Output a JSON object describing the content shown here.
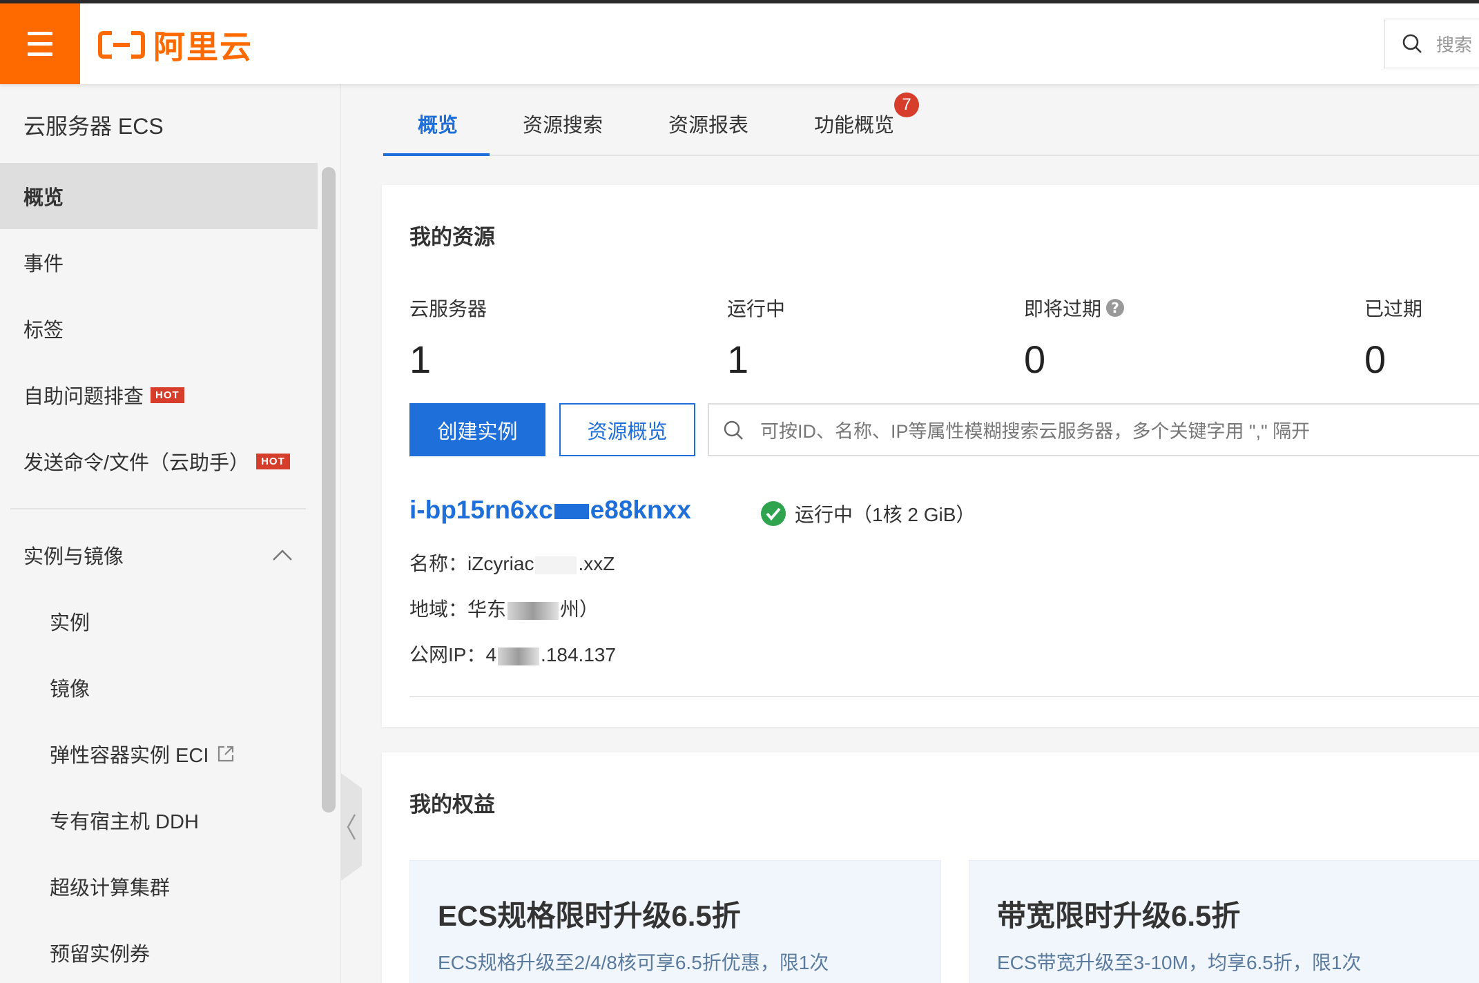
{
  "header": {
    "logo_text": "阿里云",
    "search_placeholder": "搜索"
  },
  "sidebar": {
    "title": "云服务器 ECS",
    "items": [
      {
        "label": "概览",
        "active": true
      },
      {
        "label": "事件"
      },
      {
        "label": "标签"
      },
      {
        "label": "自助问题排查",
        "badge": "HOT"
      },
      {
        "label": "发送命令/文件（云助手）",
        "badge": "HOT"
      }
    ],
    "section": {
      "label": "实例与镜像",
      "expanded": true
    },
    "sub_items": [
      {
        "label": "实例"
      },
      {
        "label": "镜像"
      },
      {
        "label": "弹性容器实例 ECI",
        "external": true
      },
      {
        "label": "专有宿主机 DDH"
      },
      {
        "label": "超级计算集群"
      },
      {
        "label": "预留实例券"
      }
    ]
  },
  "tabs": [
    {
      "label": "概览",
      "active": true
    },
    {
      "label": "资源搜索"
    },
    {
      "label": "资源报表"
    },
    {
      "label": "功能概览",
      "badge": "7"
    }
  ],
  "resources": {
    "title": "我的资源",
    "stats": [
      {
        "label": "云服务器",
        "value": "1"
      },
      {
        "label": "运行中",
        "value": "1"
      },
      {
        "label": "即将过期",
        "value": "0",
        "help": true
      },
      {
        "label": "已过期",
        "value": "0"
      }
    ],
    "create_button": "创建实例",
    "overview_button": "资源概览",
    "search_placeholder": "可按ID、名称、IP等属性模糊搜索云服务器，多个关键字用 \",\" 隔开",
    "instance": {
      "id_start": "i-bp15rn6xc",
      "id_end": "e88knxx",
      "status": "运行中（1核 2 GiB）",
      "name_label": "名称：",
      "name_start": "iZcyriac",
      "name_end": ".xxZ",
      "region_label": "地域：",
      "region_start": "华东",
      "region_end": "州）",
      "ip_label": "公网IP：",
      "ip_start": "4",
      "ip_end": ".184.137"
    }
  },
  "benefits": {
    "title": "我的权益",
    "promos": [
      {
        "title": "ECS规格限时升级6.5折",
        "subtitle": "ECS规格升级至2/4/8核可享6.5折优惠，限1次"
      },
      {
        "title": "带宽限时升级6.5折",
        "subtitle": "ECS带宽升级至3-10M，均享6.5折，限1次"
      }
    ]
  },
  "colors": {
    "brand": "#ff6a00",
    "primary": "#1e6fd9",
    "hot": "#d63d2b",
    "running": "#2ea44f"
  }
}
